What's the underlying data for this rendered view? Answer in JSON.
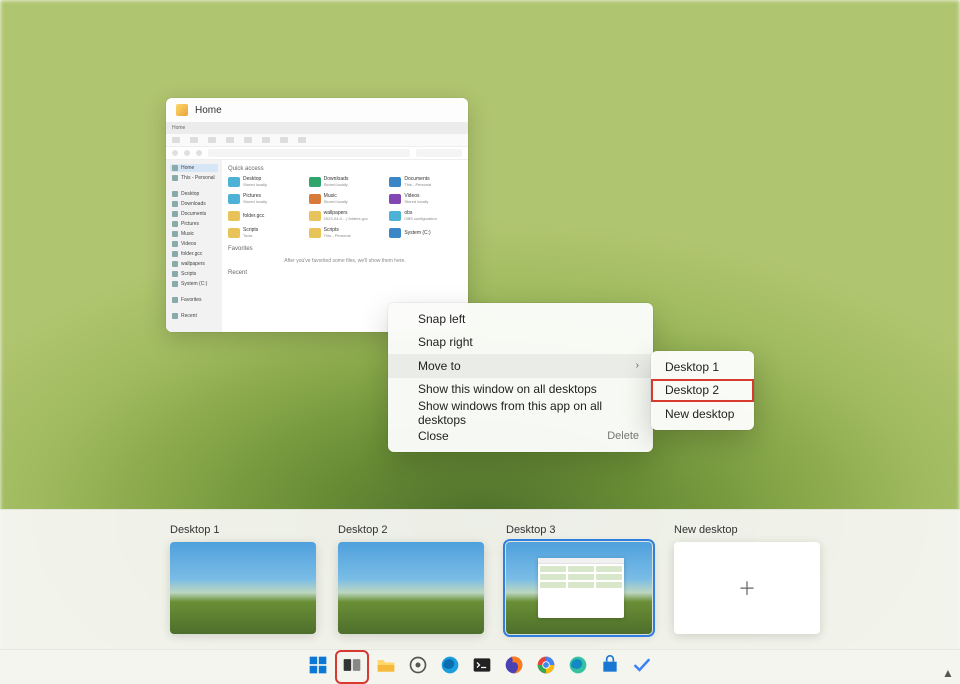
{
  "thumb_window": {
    "title": "Home",
    "tabs": [
      "Home"
    ],
    "address": "Home",
    "sidebar_heading": "Quick access",
    "sidebar": [
      "Home",
      "This - Personal",
      "",
      "Desktop",
      "Downloads",
      "Documents",
      "Pictures",
      "Music",
      "Videos",
      "folder.gcc",
      "wallpapers",
      "Scripts",
      "System (C:)",
      "",
      "Favorites",
      "",
      "Recent"
    ],
    "quick_section": "Quick access",
    "items": [
      {
        "name": "Desktop",
        "sub": "Stored locally",
        "color": "#4eb1d6"
      },
      {
        "name": "Downloads",
        "sub": "Stored locally",
        "color": "#2fa56b"
      },
      {
        "name": "Documents",
        "sub": "This - Personal",
        "color": "#3b86c7"
      },
      {
        "name": "Pictures",
        "sub": "Stored locally",
        "color": "#4eb1d6"
      },
      {
        "name": "Music",
        "sub": "Stored locally",
        "color": "#d87a3a"
      },
      {
        "name": "Videos",
        "sub": "Stored locally",
        "color": "#8347b4"
      },
      {
        "name": "folder.gcc",
        "sub": "",
        "color": "#e8c35a"
      },
      {
        "name": "wallpapers",
        "sub": "2023-04-0... | folders.gcc",
        "color": "#e8c35a"
      },
      {
        "name": "obs",
        "sub": "OBS configuration",
        "color": "#4eb1d6"
      },
      {
        "name": "Scripts",
        "sub": "Tools",
        "color": "#e8c35a"
      },
      {
        "name": "Scripts",
        "sub": "This - Personal",
        "color": "#e8c35a"
      },
      {
        "name": "System (C:)",
        "sub": "",
        "color": "#3b86c7"
      }
    ],
    "favorites_label": "Favorites",
    "favorites_hint": "After you've favorited some files, we'll show them here.",
    "recent_label": "Recent"
  },
  "context_menu": {
    "items": [
      {
        "label": "Snap left"
      },
      {
        "label": "Snap right"
      },
      {
        "label": "Move to",
        "submenu": true
      },
      {
        "label": "Show this window on all desktops"
      },
      {
        "label": "Show windows from this app on all desktops"
      },
      {
        "label": "Close",
        "hint": "Delete"
      }
    ],
    "submenu": [
      "Desktop 1",
      "Desktop 2",
      "New desktop"
    ],
    "submenu_highlight_index": 1
  },
  "desktops": {
    "list": [
      {
        "name": "Desktop 1"
      },
      {
        "name": "Desktop 2"
      },
      {
        "name": "Desktop 3",
        "active": true,
        "has_window": true
      }
    ],
    "new_label": "New desktop"
  },
  "taskbar": {
    "items": [
      {
        "name": "start"
      },
      {
        "name": "task-view",
        "highlight": true
      },
      {
        "name": "file-explorer"
      },
      {
        "name": "settings"
      },
      {
        "name": "edge"
      },
      {
        "name": "terminal"
      },
      {
        "name": "firefox"
      },
      {
        "name": "chrome"
      },
      {
        "name": "edge-dev"
      },
      {
        "name": "store"
      },
      {
        "name": "todo"
      }
    ]
  }
}
